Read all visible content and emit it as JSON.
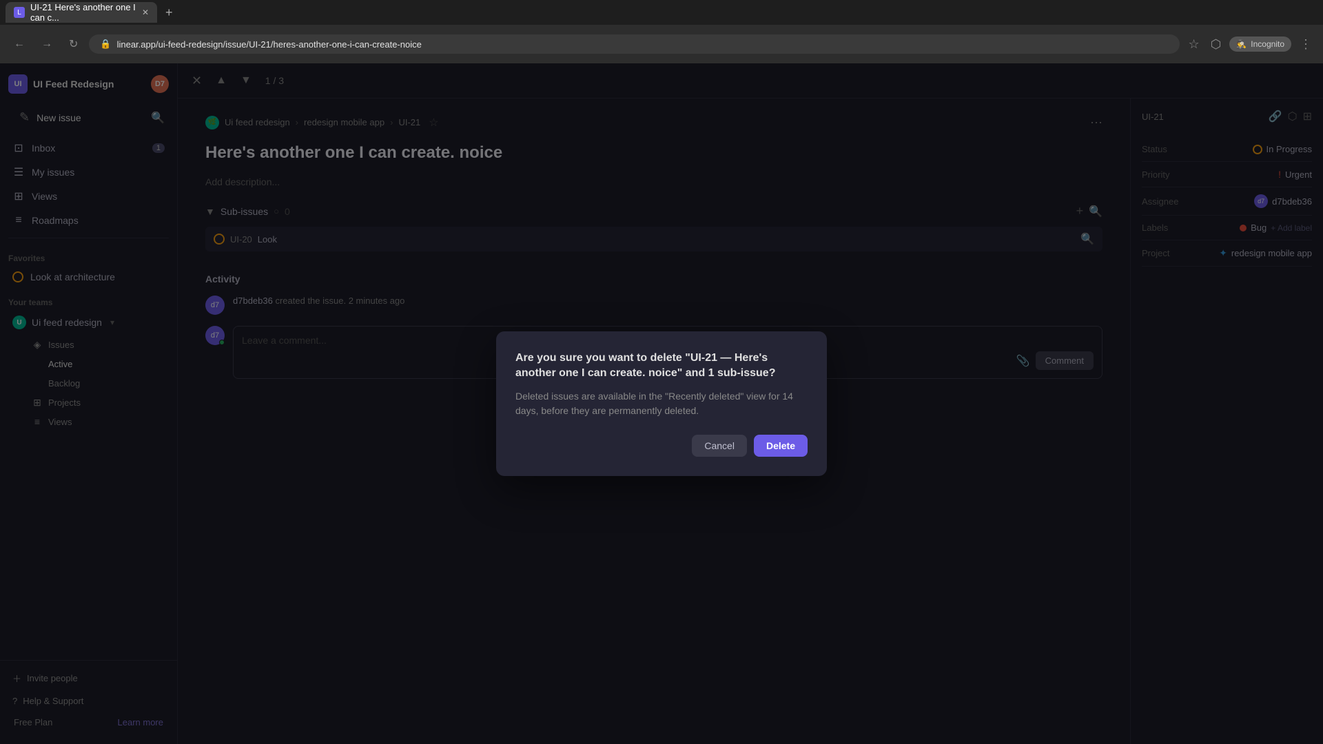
{
  "browser": {
    "tab_title": "UI-21 Here's another one I can c...",
    "tab_new_label": "+",
    "url": "linear.app/ui-feed-redesign/issue/UI-21/heres-another-one-i-can-create-noice",
    "incognito_label": "Incognito"
  },
  "sidebar": {
    "workspace_name": "UI Feed Redesign",
    "workspace_initials": "UI",
    "user_initials": "D7",
    "new_issue_label": "New issue",
    "search_placeholder": "Search",
    "nav_items": [
      {
        "label": "Inbox",
        "badge": "1",
        "icon": "📥"
      },
      {
        "label": "My issues",
        "badge": "",
        "icon": "☑️"
      },
      {
        "label": "Views",
        "badge": "",
        "icon": "⊞"
      },
      {
        "label": "Roadmaps",
        "badge": "",
        "icon": "🗺"
      }
    ],
    "favorites_label": "Favorites",
    "favorites": [
      {
        "label": "Look at architecture",
        "icon": "⭕"
      }
    ],
    "your_teams_label": "Your teams",
    "team_name": "Ui feed redesign",
    "team_initials": "U",
    "team_sub_items": [
      {
        "label": "Issues",
        "icon": "◈"
      },
      {
        "label": "Active",
        "icon": ""
      },
      {
        "label": "Backlog",
        "icon": ""
      },
      {
        "label": "Projects",
        "icon": "⊞"
      },
      {
        "label": "Views",
        "icon": "⊟"
      }
    ],
    "invite_label": "Invite people",
    "help_label": "Help & Support",
    "plan_label": "Free Plan",
    "learn_more_label": "Learn more"
  },
  "issue_toolbar": {
    "close_icon": "×",
    "prev_icon": "▲",
    "next_icon": "▼",
    "pagination": "1 / 3"
  },
  "breadcrumb": {
    "project": "Ui feed redesign",
    "sep1": "›",
    "module": "redesign mobile app",
    "sep2": "›",
    "issue_id": "UI-21",
    "more_icon": "···"
  },
  "issue": {
    "title": "Here's another one I can create. noice",
    "description_placeholder": "Add description...",
    "sub_issues_label": "Sub-issues",
    "sub_issue_id": "UI-20",
    "sub_issue_label": "Look",
    "activity_label": "Activity",
    "activity_user": "d7bdeb36",
    "activity_action": "created the issue.",
    "activity_time": "2 minutes ago",
    "comment_placeholder": "Leave a comment...",
    "comment_btn": "Comment"
  },
  "right_panel": {
    "issue_id": "UI-21",
    "status_label": "Status",
    "status_value": "In Progress",
    "priority_label": "Priority",
    "priority_value": "Urgent",
    "assignee_label": "Assignee",
    "assignee_value": "d7bdeb36",
    "labels_label": "Labels",
    "label_bug": "Bug",
    "add_label": "+ Add label",
    "project_label": "Project",
    "project_value": "redesign mobile app"
  },
  "modal": {
    "title": "Are you sure you want to delete \"UI-21 — Here's another one I can create. noice\" and 1 sub-issue?",
    "body": "Deleted issues are available in the \"Recently deleted\" view for 14 days, before they are permanently deleted.",
    "cancel_label": "Cancel",
    "delete_label": "Delete"
  }
}
